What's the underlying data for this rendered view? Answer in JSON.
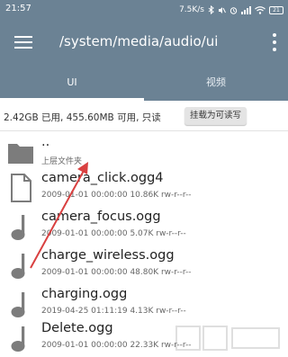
{
  "status_bar": {
    "time": "21:57",
    "speed": "7.5K/s",
    "battery": "21"
  },
  "app_bar": {
    "path": "/system/media/audio/ui",
    "menu_icon": "hamburger-menu-icon",
    "more_icon": "more-vert-icon"
  },
  "tabs": [
    {
      "label": "UI",
      "selected": true
    },
    {
      "label": "视频",
      "selected": false
    }
  ],
  "storage": {
    "info": "2.42GB 已用, 455.60MB 可用, 只读",
    "mount_button": "挂载为可读写"
  },
  "files": [
    {
      "name": "..",
      "meta": "上层文件夹",
      "icon": "folder-icon"
    },
    {
      "name": "camera_click.ogg4",
      "meta": "2009-01-01 00:00:00  10.86K  rw-r--r--",
      "icon": "document-icon"
    },
    {
      "name": "camera_focus.ogg",
      "meta": "2009-01-01 00:00:00  5.07K  rw-r--r--",
      "icon": "music-note-icon"
    },
    {
      "name": "charge_wireless.ogg",
      "meta": "2009-01-01 00:00:00  48.80K  rw-r--r--",
      "icon": "music-note-icon"
    },
    {
      "name": "charging.ogg",
      "meta": "2019-04-25 01:11:19  4.13K  rw-r--r--",
      "icon": "music-note-icon"
    },
    {
      "name": "Delete.ogg",
      "meta": "2009-01-01 00:00:00  22.33K  rw-r--r--",
      "icon": "music-note-icon"
    }
  ],
  "colors": {
    "primary": "#6b8294",
    "annotation_arrow": "#d94040",
    "icon_gray": "#777777"
  }
}
